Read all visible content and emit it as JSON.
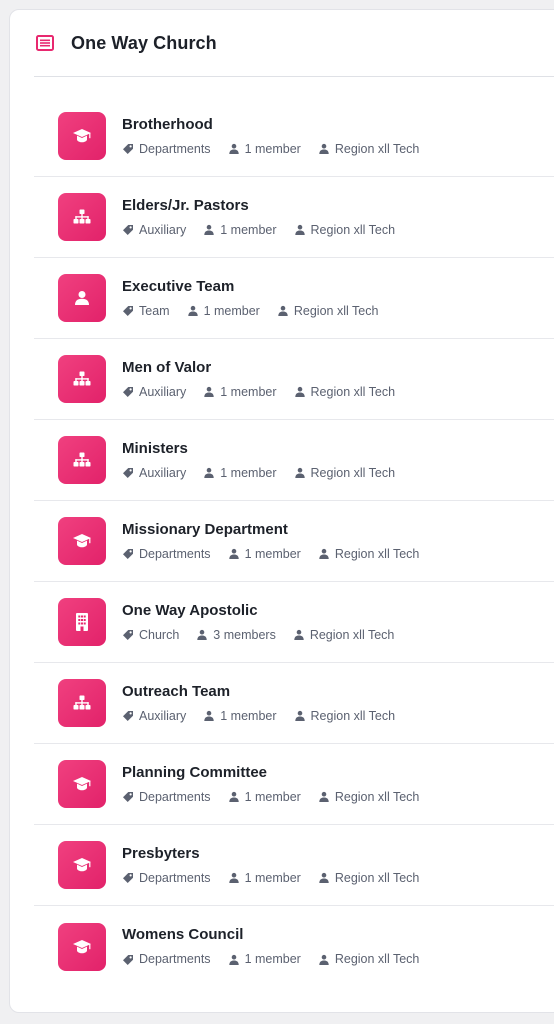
{
  "header": {
    "title": "One Way Church",
    "icon": "list-icon"
  },
  "colors": {
    "accent": "#e8286f",
    "meta_icon": "#5b6170"
  },
  "groups": [
    {
      "name": "Brotherhood",
      "type": "Departments",
      "members": "1 member",
      "owner": "Region xll Tech",
      "icon": "graduation-cap-icon"
    },
    {
      "name": "Elders/Jr. Pastors",
      "type": "Auxiliary",
      "members": "1 member",
      "owner": "Region xll Tech",
      "icon": "org-chart-icon"
    },
    {
      "name": "Executive Team",
      "type": "Team",
      "members": "1 member",
      "owner": "Region xll Tech",
      "icon": "user-icon"
    },
    {
      "name": "Men of Valor",
      "type": "Auxiliary",
      "members": "1 member",
      "owner": "Region xll Tech",
      "icon": "org-chart-icon"
    },
    {
      "name": "Ministers",
      "type": "Auxiliary",
      "members": "1 member",
      "owner": "Region xll Tech",
      "icon": "org-chart-icon"
    },
    {
      "name": "Missionary Department",
      "type": "Departments",
      "members": "1 member",
      "owner": "Region xll Tech",
      "icon": "graduation-cap-icon"
    },
    {
      "name": "One Way Apostolic",
      "type": "Church",
      "members": "3 members",
      "owner": "Region xll Tech",
      "icon": "building-icon"
    },
    {
      "name": "Outreach Team",
      "type": "Auxiliary",
      "members": "1 member",
      "owner": "Region xll Tech",
      "icon": "org-chart-icon"
    },
    {
      "name": "Planning Committee",
      "type": "Departments",
      "members": "1 member",
      "owner": "Region xll Tech",
      "icon": "graduation-cap-icon"
    },
    {
      "name": "Presbyters",
      "type": "Departments",
      "members": "1 member",
      "owner": "Region xll Tech",
      "icon": "graduation-cap-icon"
    },
    {
      "name": "Womens Council",
      "type": "Departments",
      "members": "1 member",
      "owner": "Region xll Tech",
      "icon": "graduation-cap-icon"
    }
  ]
}
